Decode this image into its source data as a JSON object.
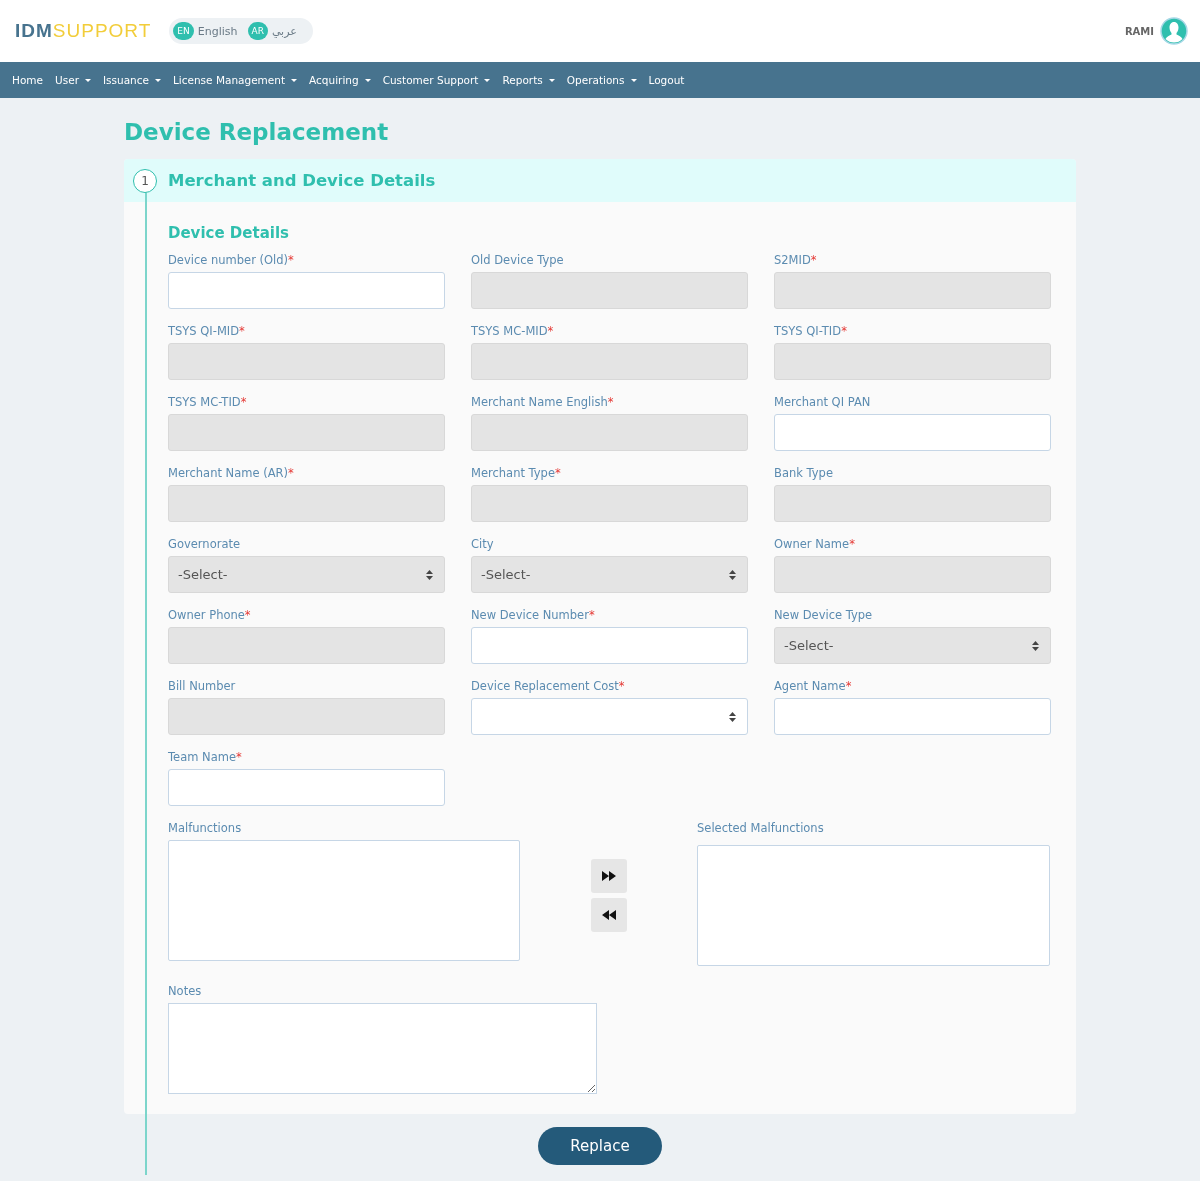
{
  "brand": {
    "strong": "IDM",
    "light": "SUPPORT"
  },
  "languages": [
    {
      "code": "EN",
      "label": "English"
    },
    {
      "code": "AR",
      "label": "عربي"
    }
  ],
  "user": {
    "name": "RAMI"
  },
  "nav": [
    {
      "label": "Home",
      "dropdown": false
    },
    {
      "label": "User",
      "dropdown": true
    },
    {
      "label": "Issuance",
      "dropdown": true
    },
    {
      "label": "License Management",
      "dropdown": true
    },
    {
      "label": "Acquiring",
      "dropdown": true
    },
    {
      "label": "Customer Support",
      "dropdown": true
    },
    {
      "label": "Reports",
      "dropdown": true
    },
    {
      "label": "Operations",
      "dropdown": true
    },
    {
      "label": "Logout",
      "dropdown": false
    }
  ],
  "page_title": "Device Replacement",
  "step": {
    "number": "1",
    "title": "Merchant and Device Details"
  },
  "section_title": "Device Details",
  "fields": [
    {
      "label": "Device number (Old)",
      "mark": "*",
      "kind": "input",
      "disabled": false
    },
    {
      "label": "Old Device Type",
      "kind": "input",
      "disabled": true
    },
    {
      "label": "S2MID",
      "mark": "*",
      "kind": "input",
      "disabled": true
    },
    {
      "label": "TSYS QI-MID",
      "mark": "*",
      "kind": "input",
      "disabled": true
    },
    {
      "label": "TSYS MC-MID",
      "mark": "*",
      "kind": "input",
      "disabled": true
    },
    {
      "label": "TSYS QI-TID",
      "mark": "*",
      "kind": "input",
      "disabled": true
    },
    {
      "label": "TSYS MC-TID",
      "mark": "*",
      "kind": "input",
      "disabled": true
    },
    {
      "label": "Merchant Name English",
      "mark": "*",
      "kind": "input",
      "disabled": true
    },
    {
      "label": "Merchant QI PAN",
      "kind": "input",
      "disabled": false
    },
    {
      "label": "Merchant Name (AR)",
      "mark": "*",
      "kind": "input",
      "disabled": true
    },
    {
      "label": "Merchant Type",
      "mark": "*",
      "kind": "input",
      "disabled": true
    },
    {
      "label": "Bank Type",
      "kind": "input",
      "disabled": true
    },
    {
      "label": "Governorate",
      "kind": "select",
      "value": "-Select-",
      "disabled": true
    },
    {
      "label": "City",
      "kind": "select",
      "value": "-Select-",
      "disabled": true
    },
    {
      "label": "Owner Name",
      "mark": "*",
      "kind": "input",
      "disabled": true
    },
    {
      "label": "Owner Phone",
      "mark": "*",
      "kind": "input",
      "disabled": true
    },
    {
      "label": "New Device Number",
      "mark": "*",
      "kind": "input",
      "disabled": false
    },
    {
      "label": "New Device Type",
      "kind": "select",
      "value": "-Select-",
      "disabled": true
    },
    {
      "label": "Bill Number",
      "kind": "input",
      "disabled": true
    },
    {
      "label": "Device Replacement Cost",
      "mark": "*",
      "kind": "select",
      "disabled": false
    },
    {
      "label": "Agent Name",
      "mark": "*",
      "kind": "input",
      "disabled": false
    },
    {
      "label": "Team Name",
      "mark": "*",
      "kind": "input",
      "disabled": false
    }
  ],
  "malfunctions": {
    "label": "Malfunctions"
  },
  "selected_malfunctions": {
    "label": "Selected Malfunctions"
  },
  "notes": {
    "label": "Notes"
  },
  "submit": "Replace"
}
